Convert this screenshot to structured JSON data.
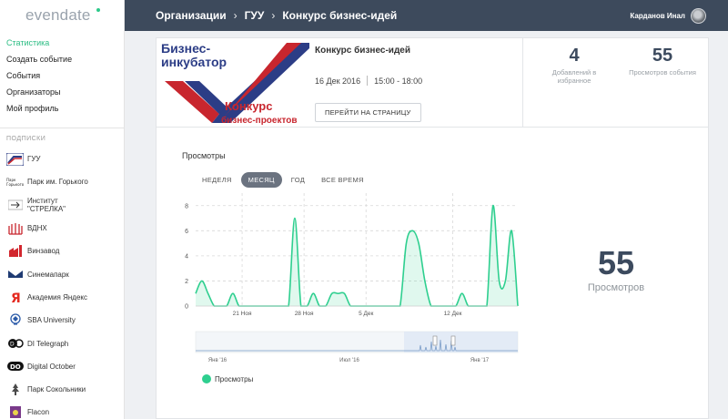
{
  "brand": {
    "name": "evendate"
  },
  "nav": [
    {
      "label": "Статистика",
      "active": true
    },
    {
      "label": "Создать событие"
    },
    {
      "label": "События"
    },
    {
      "label": "Организаторы"
    },
    {
      "label": "Мой профиль"
    }
  ],
  "subscriptions_title": "ПОДПИСКИ",
  "subscriptions": [
    {
      "label": "ГУУ",
      "icon": "guu-logo-icon"
    },
    {
      "label": "Парк им. Горького",
      "icon": "gorky-park-logo-icon"
    },
    {
      "label": "Институт \n\"СТРЕЛКА\"",
      "icon": "strelka-logo-icon"
    },
    {
      "label": "ВДНХ",
      "icon": "vdnh-logo-icon"
    },
    {
      "label": "Винзавод",
      "icon": "vinzavod-logo-icon"
    },
    {
      "label": "Синемапарк",
      "icon": "cinemapark-logo-icon"
    },
    {
      "label": "Академия Яндекс",
      "icon": "yandex-logo-icon"
    },
    {
      "label": "SBA University",
      "icon": "sba-logo-icon"
    },
    {
      "label": "DI Telegraph",
      "icon": "di-telegraph-logo-icon"
    },
    {
      "label": "Digital October",
      "icon": "digital-october-logo-icon"
    },
    {
      "label": "Парк Сокольники",
      "icon": "sokolniki-logo-icon"
    },
    {
      "label": "Flacon",
      "icon": "flacon-logo-icon"
    }
  ],
  "header": {
    "breadcrumb": [
      "Организации",
      "ГУУ",
      "Конкурс бизнес-идей"
    ],
    "user_name": "Карданов Инал"
  },
  "event": {
    "image_text": [
      "Бизнес-",
      "инкубатор",
      "Конкурс",
      "бизнес-проектов"
    ],
    "title": "Конкурс бизнес-идей",
    "date": "16 Дек 2016",
    "time": "15:00 - 18:00",
    "goto_label": "ПЕРЕЙТИ НА СТРАНИЦУ"
  },
  "stats": {
    "favorites": {
      "value": "4",
      "caption": "Добавлений в избранное"
    },
    "views": {
      "value": "55",
      "caption": "Просмотров события"
    }
  },
  "chart_section": {
    "title": "Просмотры",
    "tabs": [
      "НЕДЕЛЯ",
      "МЕСЯЦ",
      "ГОД",
      "ВСЕ ВРЕМЯ"
    ],
    "active_tab": "МЕСЯЦ",
    "legend": "Просмотры",
    "total_value": "55",
    "total_caption": "Просмотров"
  },
  "chart_data": {
    "type": "area",
    "series": [
      {
        "name": "Просмотры",
        "color": "#2ecf8f",
        "points": [
          [
            0,
            1
          ],
          [
            1,
            2
          ],
          [
            2,
            1
          ],
          [
            3,
            0
          ],
          [
            4,
            0
          ],
          [
            5,
            0
          ],
          [
            6,
            1
          ],
          [
            7,
            0
          ],
          [
            8,
            0
          ],
          [
            9,
            0
          ],
          [
            10,
            0
          ],
          [
            11,
            0
          ],
          [
            12,
            0
          ],
          [
            13,
            0
          ],
          [
            14,
            0
          ],
          [
            15,
            0
          ],
          [
            16,
            7
          ],
          [
            17,
            0
          ],
          [
            18,
            0
          ],
          [
            19,
            1
          ],
          [
            20,
            0
          ],
          [
            21,
            0
          ],
          [
            22,
            1
          ],
          [
            23,
            1
          ],
          [
            24,
            1
          ],
          [
            25,
            0
          ],
          [
            26,
            0
          ],
          [
            27,
            0
          ],
          [
            28,
            0
          ],
          [
            29,
            0
          ],
          [
            30,
            0
          ],
          [
            31,
            0
          ],
          [
            32,
            0
          ],
          [
            33,
            0
          ],
          [
            34,
            5
          ],
          [
            35,
            6
          ],
          [
            36,
            5
          ],
          [
            37,
            2
          ],
          [
            38,
            0
          ],
          [
            39,
            0
          ],
          [
            40,
            0
          ],
          [
            41,
            0
          ],
          [
            42,
            0
          ],
          [
            43,
            1
          ],
          [
            44,
            0
          ],
          [
            45,
            0
          ],
          [
            46,
            0
          ],
          [
            47,
            0
          ],
          [
            48,
            8
          ],
          [
            49,
            2
          ],
          [
            50,
            2
          ],
          [
            51,
            6
          ],
          [
            52,
            0
          ]
        ]
      }
    ],
    "x_tick_labels": [
      "21 Ноя",
      "28 Ноя",
      "5 Дек",
      "12 Дек"
    ],
    "x_tick_positions": [
      7.5,
      17.5,
      27.5,
      41.5
    ],
    "y_ticks": [
      0,
      2,
      4,
      6,
      8
    ],
    "ylim": [
      0,
      9
    ],
    "xlim": [
      0,
      52
    ],
    "navigator_labels": [
      "Янв '16",
      "Июл '16",
      "Янв '17"
    ],
    "grid": true
  }
}
